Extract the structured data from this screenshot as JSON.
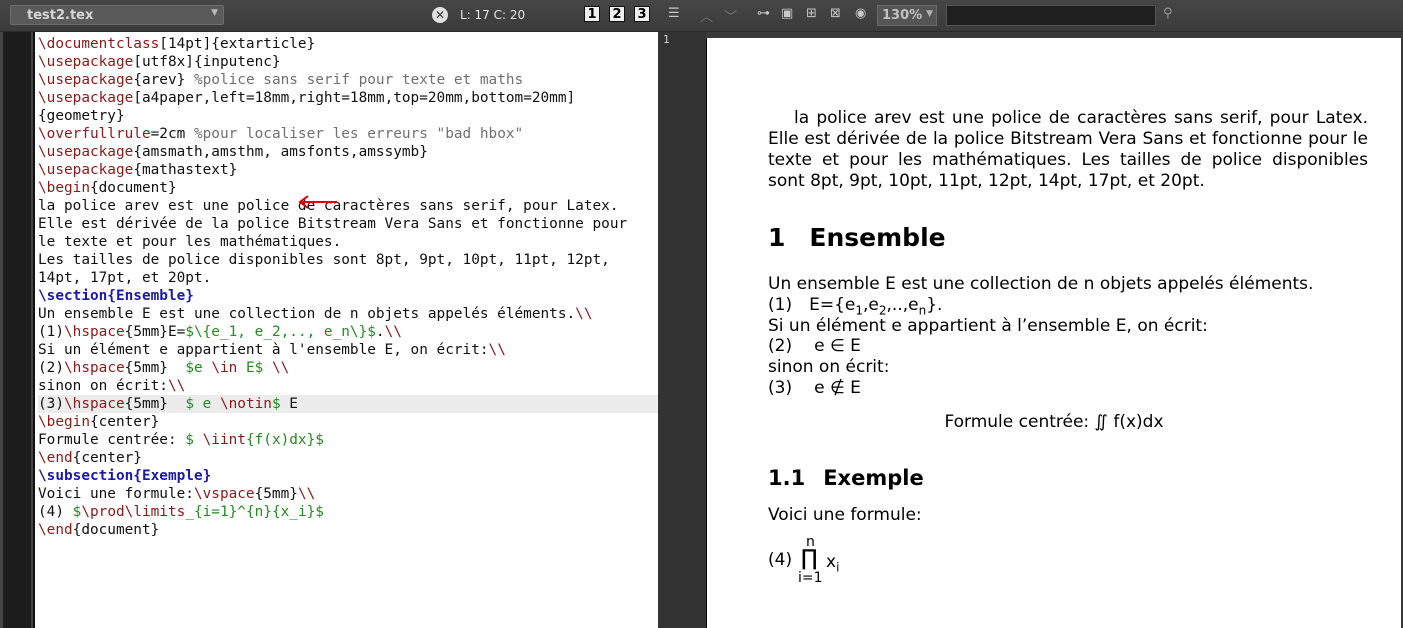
{
  "toolbar": {
    "file_name": "test2.tex",
    "cursor_position": "L: 17 C: 20",
    "view_buttons": [
      "1",
      "2",
      "3"
    ],
    "zoom": "130%",
    "search_value": ""
  },
  "editor": {
    "lines": [
      "\\documentclass[14pt]{extarticle}",
      "\\usepackage[utf8x]{inputenc}",
      "\\usepackage{arev} %police sans serif pour texte et maths",
      "\\usepackage[a4paper,left=18mm,right=18mm,top=20mm,bottom=20mm]",
      "{geometry}",
      "\\overfullrule=2cm %pour localiser les erreurs \"bad hbox\"",
      "\\usepackage{amsmath,amsthm, amsfonts,amssymb}",
      "\\usepackage{mathastext}",
      "\\begin{document}",
      "la police arev est une police de caractères sans serif, pour Latex.",
      "Elle est dérivée de la police Bitstream Vera Sans et fonctionne pour",
      "le texte et pour les mathématiques.",
      "Les tailles de police disponibles sont 8pt, 9pt, 10pt, 11pt, 12pt,",
      "14pt, 17pt, et 20pt.",
      "\\section{Ensemble}",
      "Un ensemble E est une collection de n objets appelés éléments.\\\\",
      "(1)\\hspace{5mm}E=$\\{e_1, e_2,.., e_n\\}$.\\\\",
      "Si un élément e appartient à l'ensemble E, on écrit:\\\\",
      "(2)\\hspace{5mm}  $e \\in E$ \\\\",
      "sinon on écrit:\\\\",
      "(3)\\hspace{5mm}  $ e \\notin$ E",
      "\\begin{center}",
      "Formule centrée: $ \\iint{f(x)dx}$",
      "\\end{center}",
      "\\subsection{Exemple}",
      "Voici une formule:\\vspace{5mm}\\\\",
      "(4) $\\prod\\limits_{i=1}^{n}{x_i}$",
      "\\end{document}"
    ]
  },
  "preview": {
    "page_number": "1",
    "intro": "la police arev est une police de caractères sans serif, pour Latex. Elle est dérivée de la police Bitstream Vera Sans et fonctionne pour le texte et pour les mathématiques. Les tailles de police disponibles sont 8pt, 9pt, 10pt, 11pt, 12pt, 14pt, 17pt, et 20pt.",
    "section_number": "1",
    "section_title": "Ensemble",
    "p1": "Un ensemble E est une collection de n objets appelés éléments.",
    "eq1_label": "(1)",
    "p2": "Si un élément e appartient à l’ensemble E, on écrit:",
    "eq2_label": "(2)",
    "eq2": "e ∈ E",
    "p3": "sinon on écrit:",
    "eq3_label": "(3)",
    "eq3": "e ∉ E",
    "centered_formula": "Formule centrée: ∬ f(x)dx",
    "subsection_number": "1.1",
    "subsection_title": "Exemple",
    "p4": "Voici une formule:",
    "eq4_label": "(4)",
    "prod_upper": "n",
    "prod_lower": "i=1",
    "prod_symbol": "∏",
    "prod_var": "x",
    "prod_sub": "i"
  }
}
